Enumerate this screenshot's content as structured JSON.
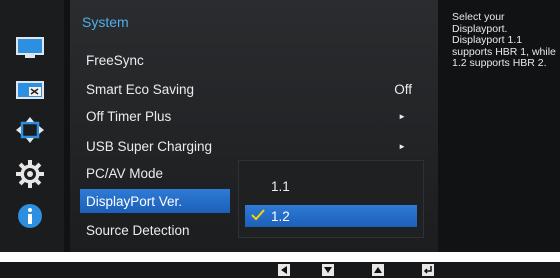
{
  "menu": {
    "title": "System",
    "items": [
      {
        "label": "FreeSync",
        "value": "",
        "has_arrow": false
      },
      {
        "label": "Smart Eco Saving",
        "value": "Off",
        "has_arrow": false
      },
      {
        "label": "Off Timer Plus",
        "value": "",
        "has_arrow": true
      },
      {
        "label": "USB Super Charging",
        "value": "",
        "has_arrow": true
      },
      {
        "label": "PC/AV Mode",
        "value": "",
        "has_arrow": false
      },
      {
        "label": "DisplayPort Ver.",
        "value": "",
        "has_arrow": false,
        "selected": true
      },
      {
        "label": "Source Detection",
        "value": "",
        "has_arrow": false
      }
    ]
  },
  "submenu": {
    "options": [
      {
        "label": "1.1",
        "selected": false
      },
      {
        "label": "1.2",
        "selected": true
      }
    ]
  },
  "help": {
    "text": "Select your Displayport. Displayport 1.1 supports HBR 1, while 1.2 supports HBR 2."
  },
  "rail_icons": [
    "picture-icon",
    "onscreen-display-icon",
    "position-arrows-icon",
    "gear-icon",
    "info-icon"
  ],
  "key_guide": [
    "left-arrow-key-icon",
    "down-arrow-key-icon",
    "up-arrow-key-icon",
    "enter-key-icon"
  ],
  "colors": {
    "accent": "#4fb0e8",
    "selection": "#2470c8",
    "background": "#101214"
  }
}
